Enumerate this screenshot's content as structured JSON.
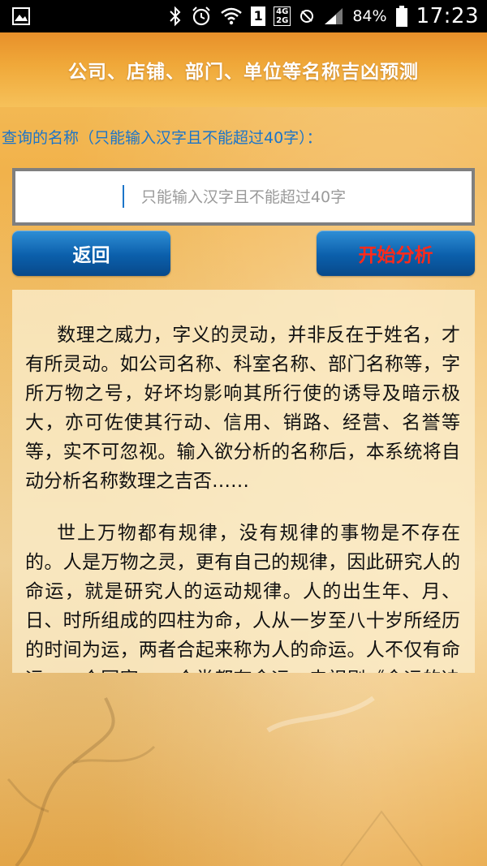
{
  "status_bar": {
    "battery_percent": "84%",
    "time": "17:23",
    "sim_slot": "1",
    "network_top": "4G",
    "network_bottom": "2G",
    "icons": [
      "gallery-icon",
      "bluetooth-icon",
      "alarm-icon",
      "wifi-icon",
      "mute-icon",
      "signal-icon",
      "battery-icon"
    ]
  },
  "header": {
    "title": "公司、店铺、部门、单位等名称吉凶预测"
  },
  "form": {
    "label": "查询的名称（只能输入汉字且不能超过40字）：",
    "input_value": "",
    "input_placeholder": "只能输入汉字且不能超过40字"
  },
  "buttons": {
    "back_label": "返回",
    "start_label": "开始分析"
  },
  "info": {
    "paragraphs": [
      "数理之威力，字义的灵动，并非反在于姓名，才有所灵动。如公司名称、科室名称、部门名称等，字所万物之号，好坏均影响其所行使的诱导及暗示极大，亦可佐使其行动、信用、销路、经营、名誉等等，实不可忽视。输入欲分析的名称后，本系统将自动分析名称数理之吉否……",
      "世上万物都有规律，没有规律的事物是不存在的。人是万物之灵，更有自己的规律，因此研究人的命运，就是研究人的运动规律。人的出生年、月、日、时所组成的四柱为命，人从一岁至八十岁所经历的时间为运，两者合起来称为人的命运。人不仅有命运，一个国家，一个党都有命运。电视剧《命运的决战》中，毛泽东同志在党"
    ]
  },
  "colors": {
    "label_blue": "#1c75c9",
    "start_red": "#ff2a1a",
    "button_blue": "#0b5fab"
  }
}
